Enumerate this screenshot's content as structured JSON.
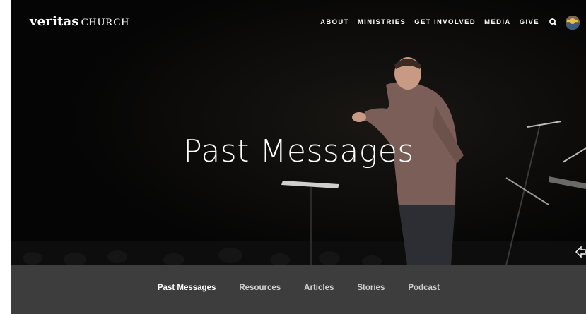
{
  "header": {
    "logo_bold": "veritas",
    "logo_light": "CHURCH",
    "nav": [
      "ABOUT",
      "MINISTRIES",
      "GET INVOLVED",
      "MEDIA",
      "GIVE"
    ],
    "search_icon": "search-icon",
    "avatar": "user-avatar"
  },
  "hero": {
    "title": "Past Messages"
  },
  "subnav": {
    "items": [
      "Past Messages",
      "Resources",
      "Articles",
      "Stories",
      "Podcast"
    ],
    "active": "Past Messages"
  },
  "colors": {
    "hero_background": "#0a0a0a",
    "subnav_background": "#3d3d3d",
    "text": "#ffffff"
  }
}
